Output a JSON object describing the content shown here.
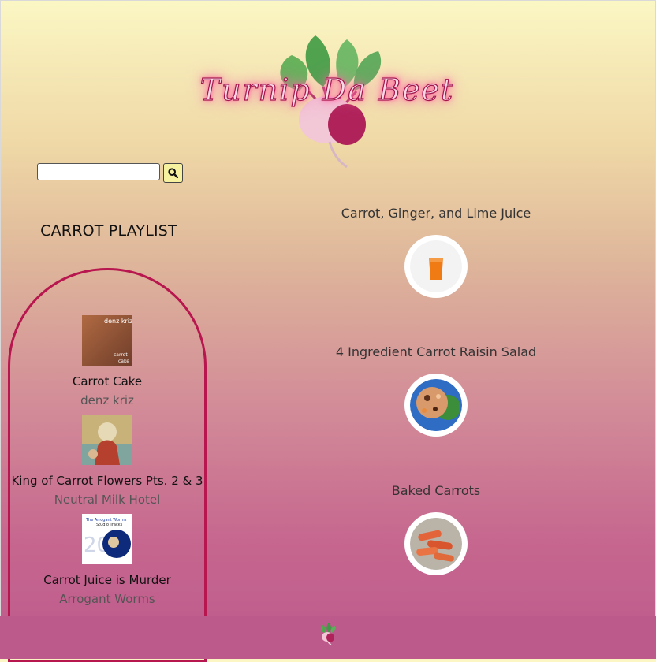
{
  "site": {
    "logo_text": "Turnip Da Beet"
  },
  "search": {
    "placeholder": "",
    "value": "",
    "button_icon": "search-icon"
  },
  "playlist": {
    "title": "CARROT PLAYLIST",
    "tracks": [
      {
        "song": "Carrot Cake",
        "artist": "denz kriz",
        "art_text_top": "denz kriz",
        "art_text_bottom": "carrot cake"
      },
      {
        "song": "King of Carrot Flowers Pts. 2 & 3",
        "artist": "Neutral Milk Hotel"
      },
      {
        "song": "Carrot Juice is Murder",
        "artist": "Arrogant Worms",
        "art_text_top": "The Arrogant Worms",
        "art_text_mid": "Studio Tracks",
        "art_number": "20"
      }
    ]
  },
  "recipes": [
    {
      "name": "Carrot, Ginger, and Lime Juice",
      "image": "orange-juice-glass"
    },
    {
      "name": "4 Ingredient Carrot Raisin Salad",
      "image": "carrot-raisin-salad"
    },
    {
      "name": "Baked Carrots",
      "image": "baked-carrots"
    }
  ],
  "colors": {
    "accent": "#b8164e",
    "footer": "#bd5a8c",
    "search_button": "#f6f19e"
  }
}
